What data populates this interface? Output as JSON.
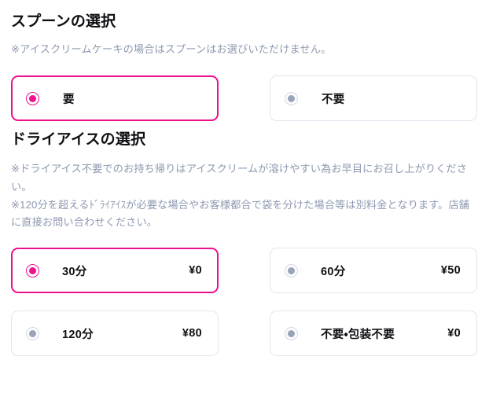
{
  "sections": [
    {
      "id": "spoon",
      "title": "スプーンの選択",
      "note": "※アイスクリームケーキの場合はスプーンはお選びいただけません。",
      "options": [
        {
          "label": "要",
          "price": "",
          "selected": true
        },
        {
          "label": "不要",
          "price": "",
          "selected": false
        }
      ]
    },
    {
      "id": "ice",
      "title": "ドライアイスの選択",
      "note": "※ドライアイス不要でのお持ち帰りはアイスクリームが溶けやすい為お早目にお召し上がりください。\n※120分を超えるﾄﾞﾗｲｱｲｽが必要な場合やお客様都合で袋を分けた場合等は別料金となります。店舗に直接お問い合わせください。",
      "options": [
        {
          "label": "30分",
          "price": "¥0",
          "selected": true
        },
        {
          "label": "60分",
          "price": "¥50",
          "selected": false
        },
        {
          "label": "120分",
          "price": "¥80",
          "selected": false
        },
        {
          "label": "不要・包装不要",
          "price": "¥0",
          "selected": false
        }
      ]
    }
  ],
  "colors": {
    "accent": "#ee1291",
    "border": "#e1e5ee",
    "note_text": "#8e99b0",
    "title_text": "#101014",
    "radio_dot_unselected": "#9aa4b8"
  }
}
